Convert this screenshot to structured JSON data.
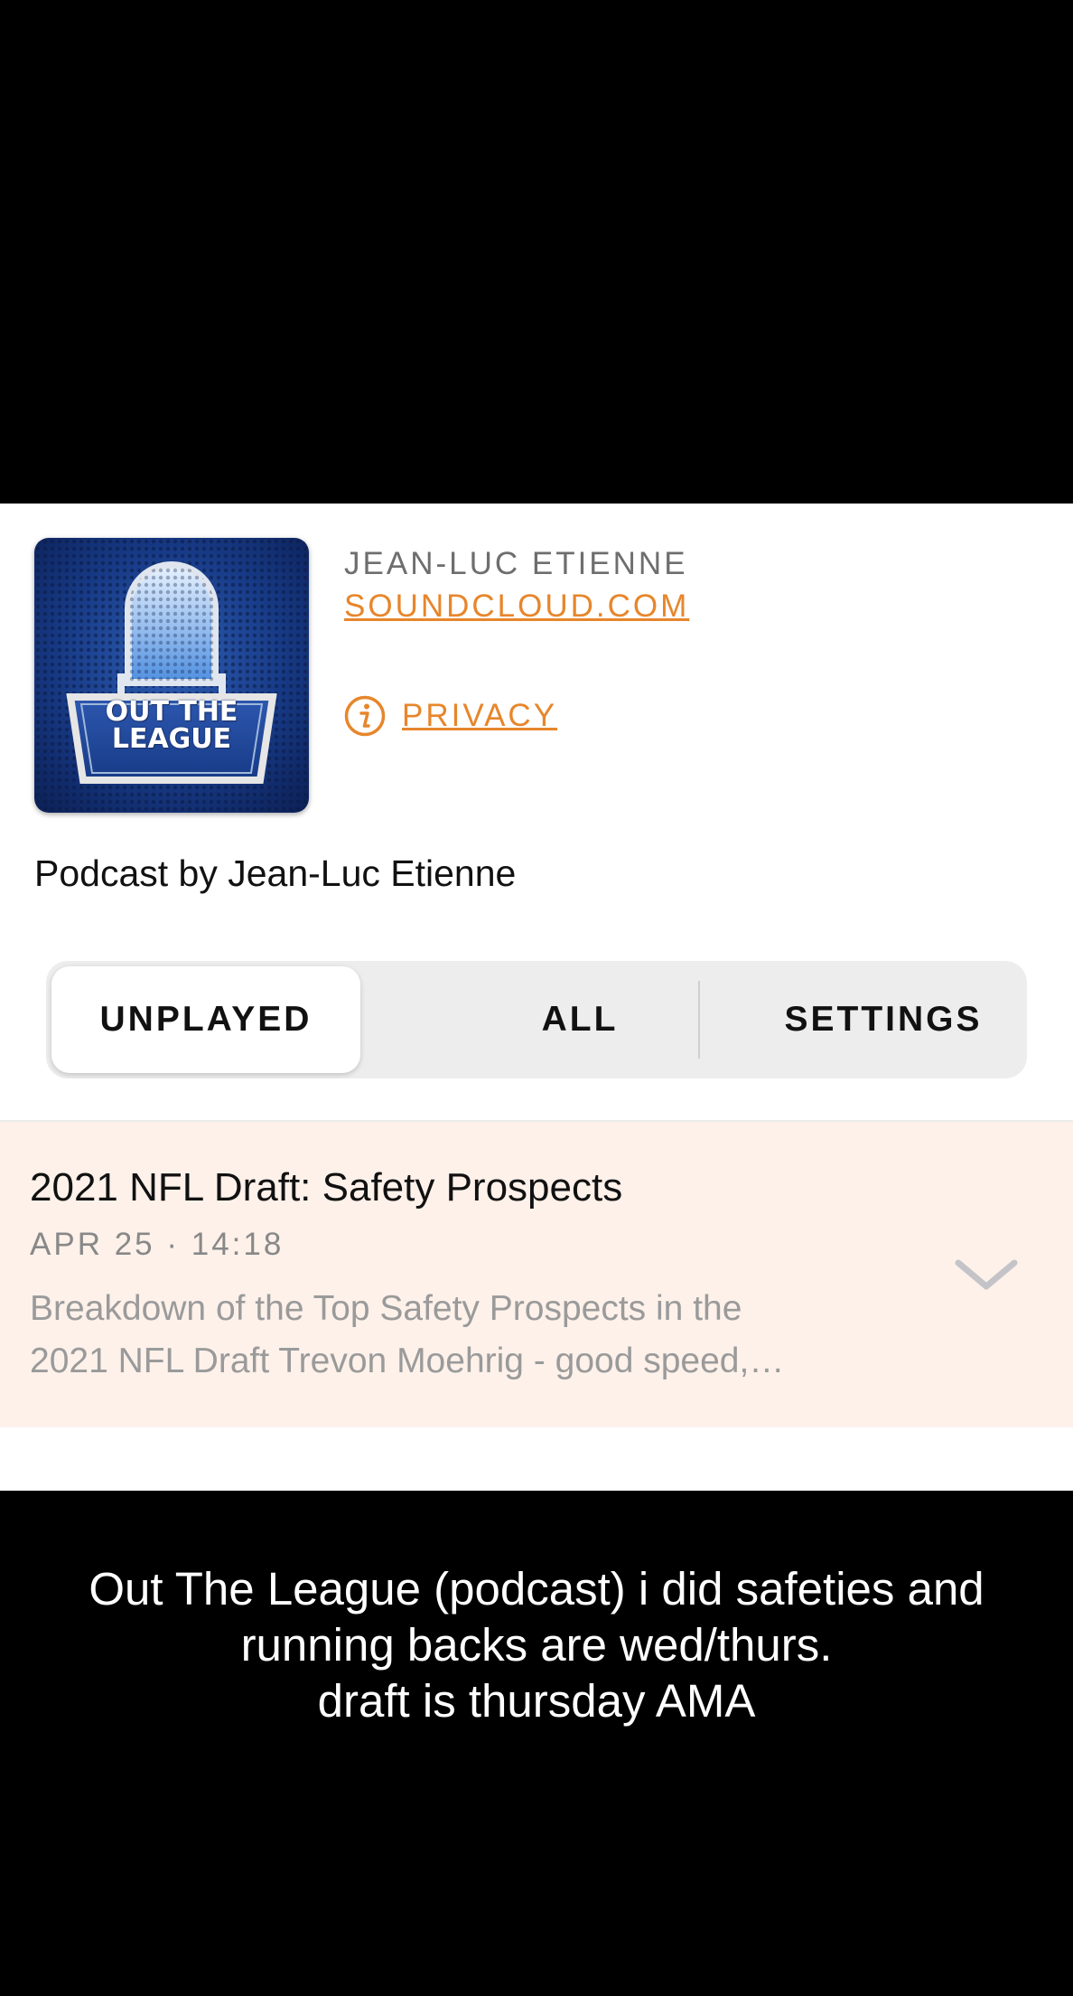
{
  "podcast": {
    "artwork": {
      "name": "out-the-league-artwork",
      "line1": "OUT THE",
      "line2": "LEAGUE"
    },
    "author": "JEAN-LUC ETIENNE",
    "source_link": "SOUNDCLOUD.COM",
    "privacy_label": "PRIVACY",
    "description": "Podcast by Jean-Luc Etienne"
  },
  "tabs": [
    {
      "label": "UNPLAYED",
      "selected": true
    },
    {
      "label": "ALL",
      "selected": false
    },
    {
      "label": "SETTINGS",
      "selected": false
    }
  ],
  "episode": {
    "title": "2021 NFL Draft: Safety Prospects",
    "meta": "APR 25 · 14:18",
    "description_line1": "Breakdown of the Top Safety Prospects in the",
    "description_line2": "2021 NFL Draft Trevon Moehrig - good speed,…",
    "expand_icon": "chevron-down-icon"
  },
  "caption": {
    "line1": "Out The League (podcast) i did safeties and",
    "line2": "running backs are wed/thurs.",
    "line3": "draft is thursday AMA"
  },
  "colors": {
    "accent": "#e7862b",
    "episode_background": "#fdf1ea",
    "segmented_background": "#ededed",
    "page_background": "#000000"
  }
}
